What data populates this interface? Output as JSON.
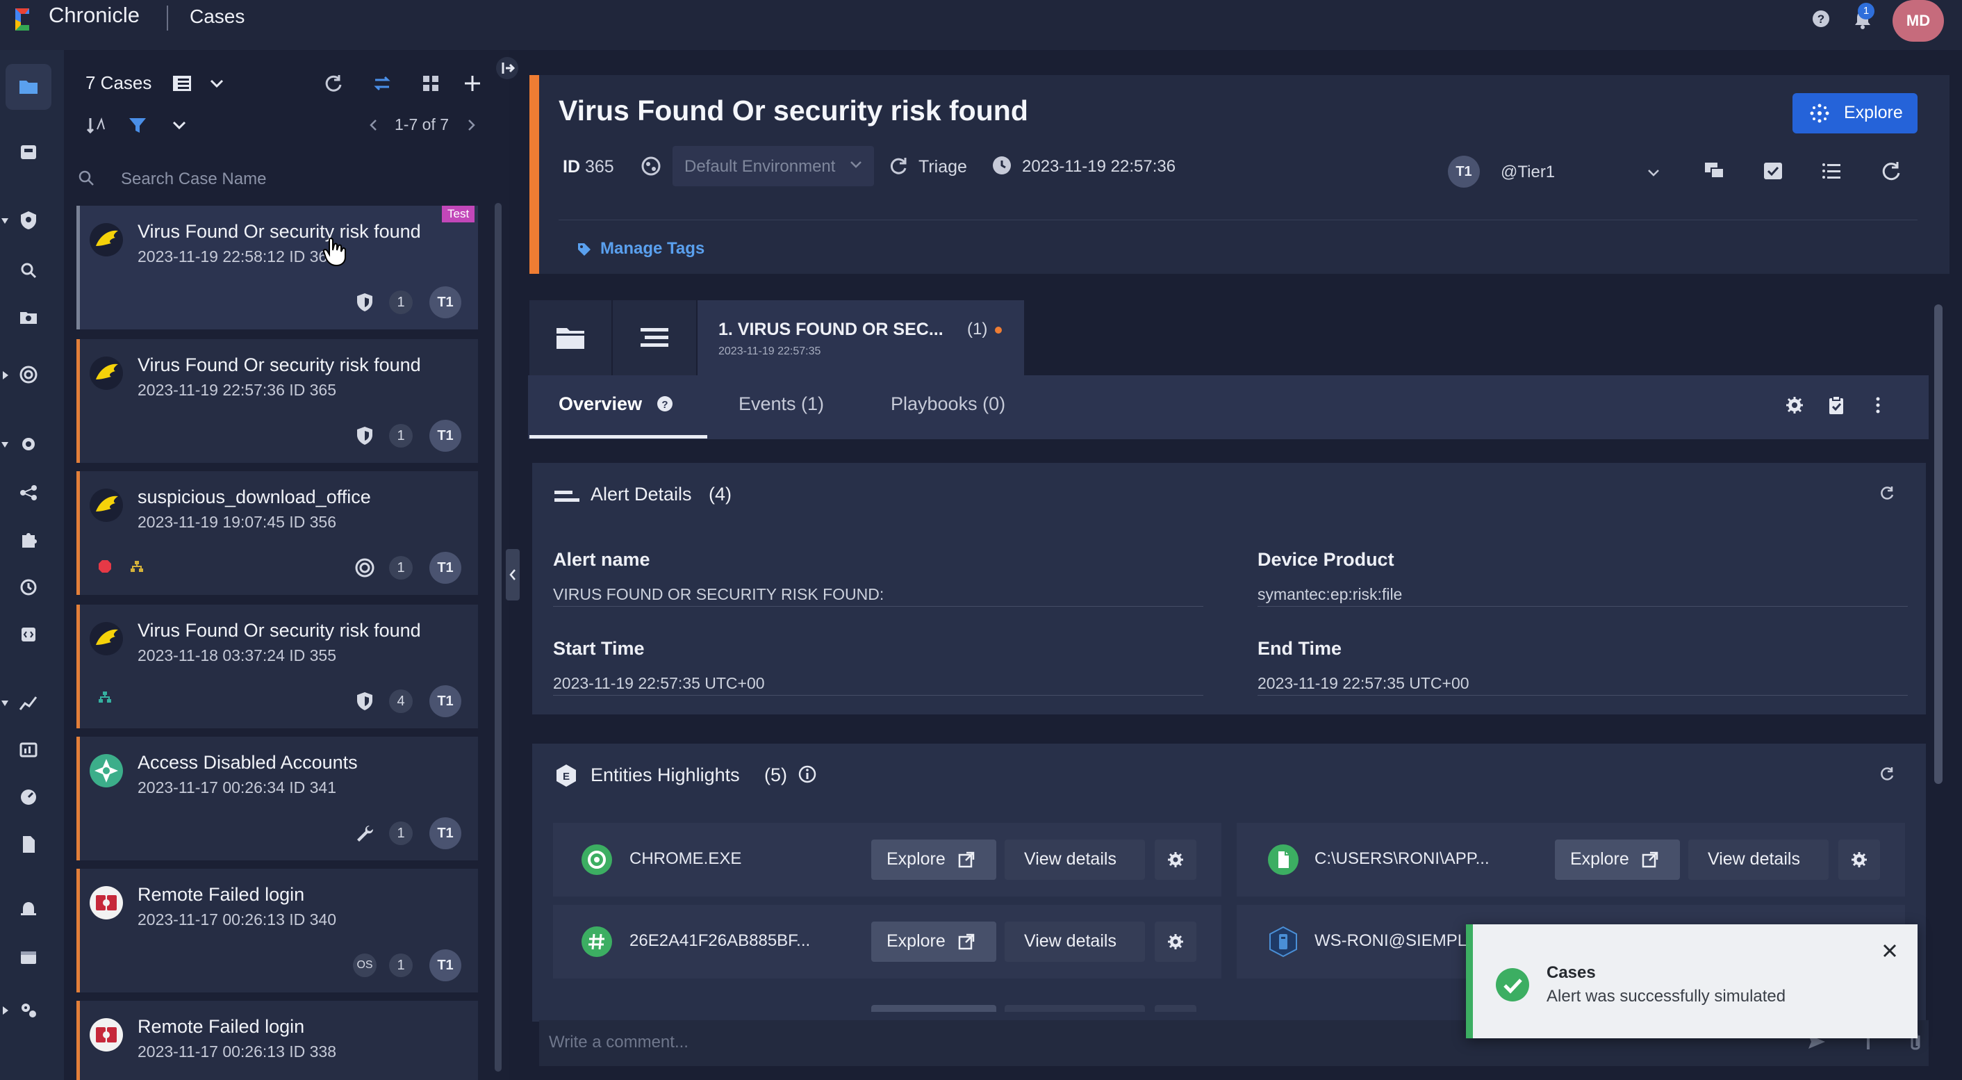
{
  "app": {
    "brand": "Chronicle",
    "page_title": "Cases"
  },
  "topbar": {
    "notification_count": "1",
    "user_initials": "MD"
  },
  "case_list": {
    "count_label": "7 Cases",
    "pagination": "1-7 of 7",
    "search_placeholder": "Search Case Name",
    "cases": [
      {
        "title": "Virus Found Or security risk found",
        "meta": "2023-11-19 22:58:12   ID 36",
        "count": "1",
        "tier": "T1",
        "badge": "Test",
        "avatar_icon": "wing-icon",
        "foot_icon": "shield-icon"
      },
      {
        "title": "Virus Found Or security risk found",
        "meta": "2023-11-19 22:57:36   ID 365",
        "count": "1",
        "tier": "T1",
        "avatar_icon": "wing-icon",
        "foot_icon": "shield-icon"
      },
      {
        "title": "suspicious_download_office",
        "meta": "2023-11-19 19:07:45   ID 356",
        "count": "1",
        "tier": "T1",
        "avatar_icon": "wing-icon",
        "foot_icon": "target-icon"
      },
      {
        "title": "Virus Found Or security risk found",
        "meta": "2023-11-18 03:37:24   ID 355",
        "count": "4",
        "tier": "T1",
        "avatar_icon": "wing-icon",
        "foot_icon": "shield-icon"
      },
      {
        "title": "Access Disabled Accounts",
        "meta": "2023-11-17 00:26:34   ID 341",
        "count": "1",
        "tier": "T1",
        "avatar_icon": "puzzle-badge-icon",
        "foot_icon": "wrench-icon"
      },
      {
        "title": "Remote Failed login",
        "meta": "2023-11-17 00:26:13   ID 340",
        "count": "1",
        "tier": "T1",
        "avatar_icon": "login-badge-icon",
        "foot_icon": "os-icon",
        "foot_text": "OS"
      },
      {
        "title": "Remote Failed login",
        "meta": "2023-11-17 00:26:13   ID 338",
        "avatar_icon": "login-badge-icon"
      }
    ]
  },
  "case": {
    "title": "Virus Found Or security risk found",
    "id_label": "ID",
    "id_value": "365",
    "environment": "Default Environment",
    "stage": "Triage",
    "time": "2023-11-19 22:57:36",
    "assignee_initials": "T1",
    "assignee": "@Tier1",
    "explore_label": "Explore",
    "manage_tags": "Manage Tags"
  },
  "alert_tab": {
    "title": "1. VIRUS FOUND OR SEC...",
    "count": "(1)",
    "date": "2023-11-19 22:57:35"
  },
  "tabs": [
    {
      "label": "Overview"
    },
    {
      "label": "Events (1)"
    },
    {
      "label": "Playbooks (0)"
    }
  ],
  "alert_details": {
    "title": "Alert Details",
    "count": "(4)",
    "fields": [
      {
        "label": "Alert name",
        "value": "VIRUS FOUND OR SECURITY RISK FOUND:"
      },
      {
        "label": "Device Product",
        "value": "symantec:ep:risk:file"
      },
      {
        "label": "Start Time",
        "value": "2023-11-19 22:57:35 UTC+00"
      },
      {
        "label": "End Time",
        "value": "2023-11-19 22:57:35 UTC+00"
      }
    ]
  },
  "entities": {
    "title": "Entities Highlights",
    "count": "(5)",
    "explore_label": "Explore",
    "details_label": "View details",
    "items": [
      {
        "name": "CHROME.EXE",
        "icon": "process-icon",
        "color": "#3cae62"
      },
      {
        "name": "C:\\USERS\\RONI\\APP...",
        "icon": "file-icon",
        "color": "#3cae62"
      },
      {
        "name": "26E2A41F26AB885BF...",
        "icon": "hash-icon",
        "color": "#3cae62"
      },
      {
        "name": "WS-RONI@SIEMPLII",
        "icon": "host-icon",
        "color": "#4a8fd6"
      }
    ]
  },
  "comment": {
    "placeholder": "Write a comment..."
  },
  "toast": {
    "title": "Cases",
    "message": "Alert was successfully simulated"
  },
  "colors": {
    "accent": "#ef7d33",
    "primary": "#2563d9",
    "link": "#5aa0ee",
    "success": "#3cae62"
  }
}
